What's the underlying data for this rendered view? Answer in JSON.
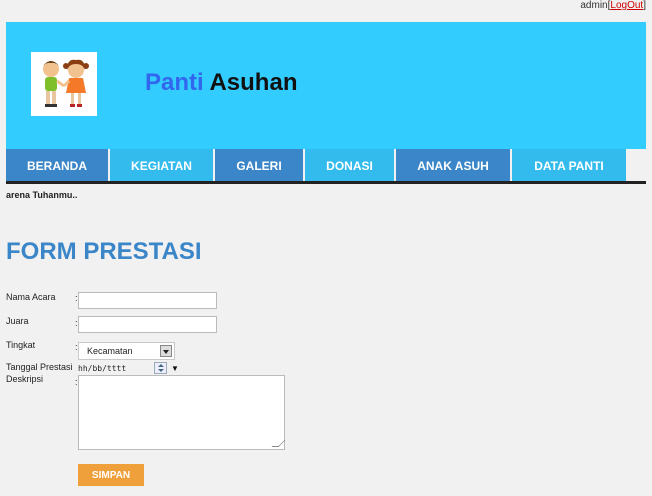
{
  "topbar": {
    "user": "admin",
    "logout_open": "[",
    "logout": "LogOut",
    "logout_close": "]"
  },
  "header": {
    "title_part1": "Panti",
    "title_part2": "Asuhan",
    "logo_icon": "children-logo-icon"
  },
  "nav": {
    "items": [
      {
        "label": "BERANDA"
      },
      {
        "label": "KEGIATAN"
      },
      {
        "label": "GALERI"
      },
      {
        "label": "DONASI"
      },
      {
        "label": "ANAK ASUH"
      },
      {
        "label": "DATA PANTI"
      }
    ]
  },
  "marquee": {
    "text": "arena Tuhanmu.."
  },
  "form": {
    "title": "FORM PRESTASI",
    "fields": [
      {
        "label": "Nama Acara",
        "colon": ":",
        "value": ""
      },
      {
        "label": "Juara",
        "colon": ":",
        "value": ""
      },
      {
        "label": "Tingkat",
        "colon": ":",
        "selected": "Kecamatan"
      },
      {
        "label": "Tanggal Prestasi",
        "colon": ":",
        "value": "hh/bb/tttt"
      },
      {
        "label": "Deskripsi",
        "colon": ":",
        "value": ""
      }
    ],
    "submit": "SIMPAN"
  },
  "colors": {
    "header_bg": "#33ccff",
    "nav_odd": "#3a86c8",
    "nav_even": "#33bbee",
    "title_blue": "#3a86c8",
    "button": "#f0a03a"
  }
}
